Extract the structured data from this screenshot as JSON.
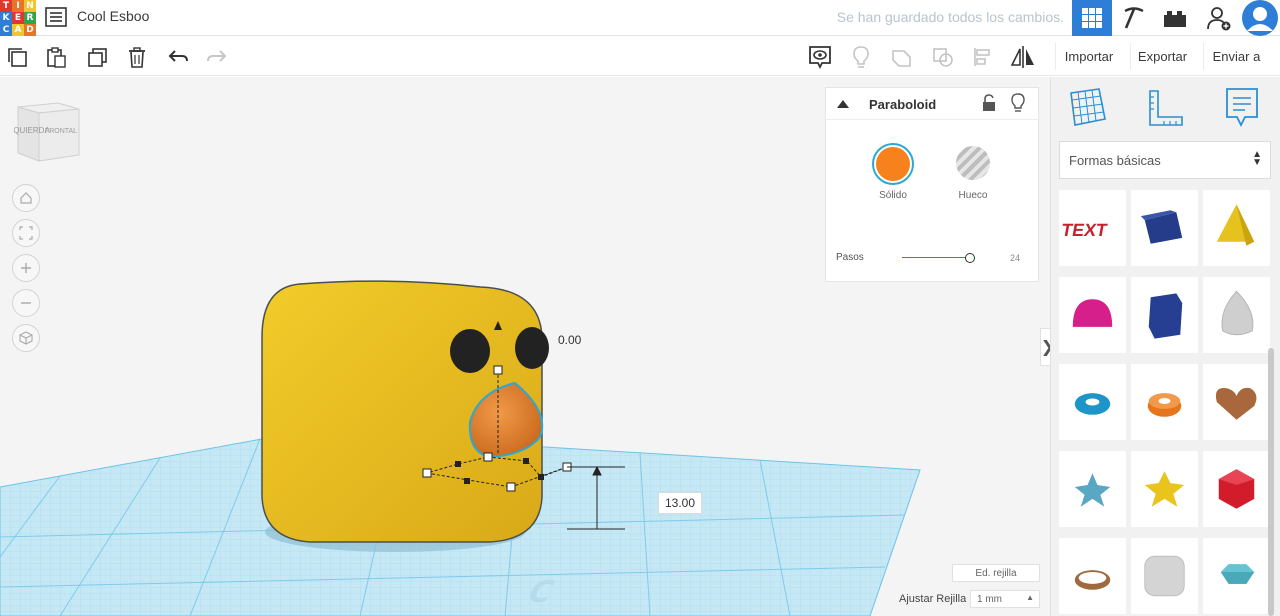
{
  "app": {
    "logo_letters": [
      "T",
      "I",
      "N",
      "K",
      "E",
      "R",
      "C",
      "A",
      "D"
    ],
    "logo_colors": [
      "#e0372c",
      "#e6742b",
      "#f1c52e",
      "#2e7dd7",
      "#e0372c",
      "#37a24b",
      "#2e7dd7",
      "#f1c52e",
      "#e6742b"
    ],
    "design_title": "Cool Esboo",
    "save_status": "Se han guardado todos los cambios."
  },
  "toolbar": {
    "import_label": "Importar",
    "export_label": "Exportar",
    "send_label": "Enviar a"
  },
  "viewcube": {
    "left_face": "IZQUIERDA",
    "front_face": "FRONTAL"
  },
  "inspector": {
    "shape_name": "Paraboloid",
    "solid_label": "Sólido",
    "hole_label": "Hueco",
    "solid_color": "#f7821d",
    "steps_label": "Pasos",
    "steps_value": "24",
    "steps_level": 0.95
  },
  "panel": {
    "category": "Formas básicas",
    "shapes": [
      {
        "name": "text-shape",
        "color": "#c8202c"
      },
      {
        "name": "box-shape",
        "color": "#243c8a"
      },
      {
        "name": "pyramid-shape",
        "color": "#e5c21d"
      },
      {
        "name": "half-sphere-shape",
        "color": "#d61f8a"
      },
      {
        "name": "polygon-shape",
        "color": "#263f93"
      },
      {
        "name": "paraboloid-shape",
        "color": "#cfcfcf"
      },
      {
        "name": "torus-shape",
        "color": "#1e95c8"
      },
      {
        "name": "tube-shape",
        "color": "#e6761c"
      },
      {
        "name": "heart-shape",
        "color": "#a8673c"
      },
      {
        "name": "star-shape",
        "color": "#5aa7c3"
      },
      {
        "name": "star-yellow-shape",
        "color": "#e8c41d"
      },
      {
        "name": "icosahedron-shape",
        "color": "#d31c2b"
      },
      {
        "name": "ring-shape",
        "color": "#a06a3e"
      },
      {
        "name": "rounded-box-shape",
        "color": "#d4d4d4"
      },
      {
        "name": "diamond-shape",
        "color": "#66c3d1"
      }
    ]
  },
  "scene": {
    "rotation_value": "0.00",
    "height_value": "13.00",
    "body_color": "#f0c419",
    "beak_color": "#e67f22",
    "eye_color": "#222222"
  },
  "grid": {
    "edit_grid_label": "Ed. rejilla",
    "snap_label": "Ajustar Rejilla",
    "snap_value": "1 mm"
  }
}
